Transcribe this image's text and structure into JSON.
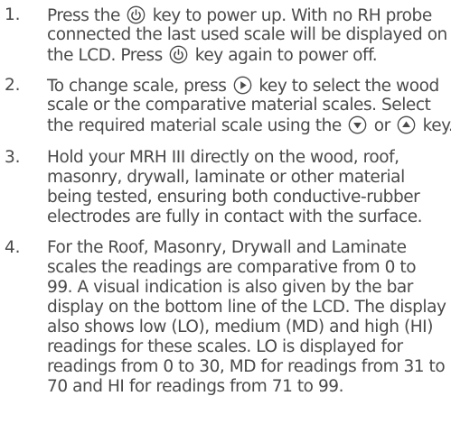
{
  "steps": [
    {
      "number": "1.",
      "lines": [
        {
          "parts": [
            "Press the",
            " key to power up. With no RH probe"
          ],
          "icon": "power-icon"
        },
        {
          "text": "connected the last used scale will be displayed on"
        },
        {
          "parts": [
            "the LCD. Press",
            " key again to power off."
          ],
          "icon": "power-icon"
        }
      ]
    },
    {
      "number": "2.",
      "lines": [
        {
          "parts": [
            "To change scale, press",
            "key to select the wood"
          ],
          "icon": "play-right-icon"
        },
        {
          "text": "scale or the comparative material scales. Select"
        },
        {
          "parts": [
            "the required material scale using the",
            " or",
            " key."
          ],
          "icons": [
            "arrow-down-icon",
            "arrow-up-icon"
          ]
        }
      ]
    },
    {
      "number": "3.",
      "lines": [
        {
          "text": "Hold your MRH III directly on the wood, roof,"
        },
        {
          "text": "masonry, drywall, laminate or other material"
        },
        {
          "text": "being tested, ensuring both conductive-rubber"
        },
        {
          "text": "electrodes are fully in contact with the surface."
        }
      ]
    },
    {
      "number": "4.",
      "lines": [
        {
          "text": "For the Roof, Masonry, Drywall and Laminate"
        },
        {
          "text": "scales the readings are comparative from 0 to"
        },
        {
          "text": "99. A visual indication is also given by the bar"
        },
        {
          "text": "display on the bottom line of the LCD. The display"
        },
        {
          "text": "also shows low (LO), medium (MD) and high (HI)"
        },
        {
          "text": "readings for these scales. LO is displayed for"
        },
        {
          "text": "readings from 0 to 30, MD for readings from 31 to"
        },
        {
          "text": "70 and HI for readings from 71 to 99."
        }
      ]
    }
  ]
}
